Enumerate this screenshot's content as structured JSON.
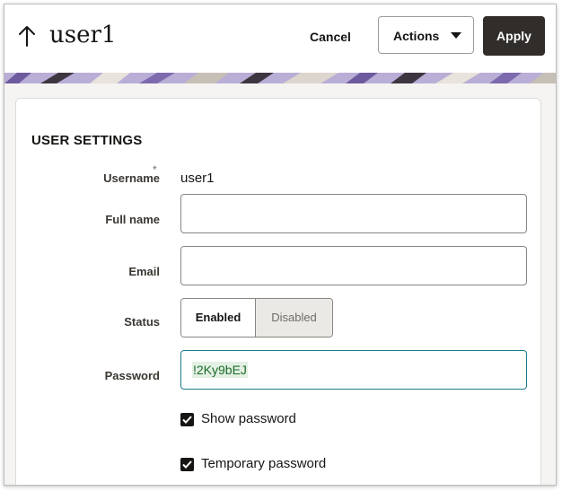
{
  "header": {
    "title": "user1",
    "cancel_label": "Cancel",
    "actions_label": "Actions",
    "apply_label": "Apply"
  },
  "section": {
    "title": "USER SETTINGS"
  },
  "fields": {
    "username": {
      "label": "Username",
      "required_mark": "*",
      "value": "user1"
    },
    "full_name": {
      "label": "Full name",
      "value": ""
    },
    "email": {
      "label": "Email",
      "value": ""
    },
    "status": {
      "label": "Status",
      "options": [
        "Enabled",
        "Disabled"
      ],
      "selected": "Enabled"
    },
    "password": {
      "label": "Password",
      "value": "!2Ky9bEJ"
    }
  },
  "checkboxes": {
    "show_password": {
      "label": "Show password",
      "checked": true
    },
    "temporary_password": {
      "label": "Temporary password",
      "checked": true
    }
  },
  "colors": {
    "primary_button": "#312d2a",
    "focus_border": "#1d7a8a",
    "password_text": "#1b6d2a",
    "banner_purple": "#9b87c4"
  },
  "icons": {
    "back": "up-arrow-icon",
    "actions_caret": "caret-down-icon",
    "checkbox": "checkmark-icon"
  }
}
